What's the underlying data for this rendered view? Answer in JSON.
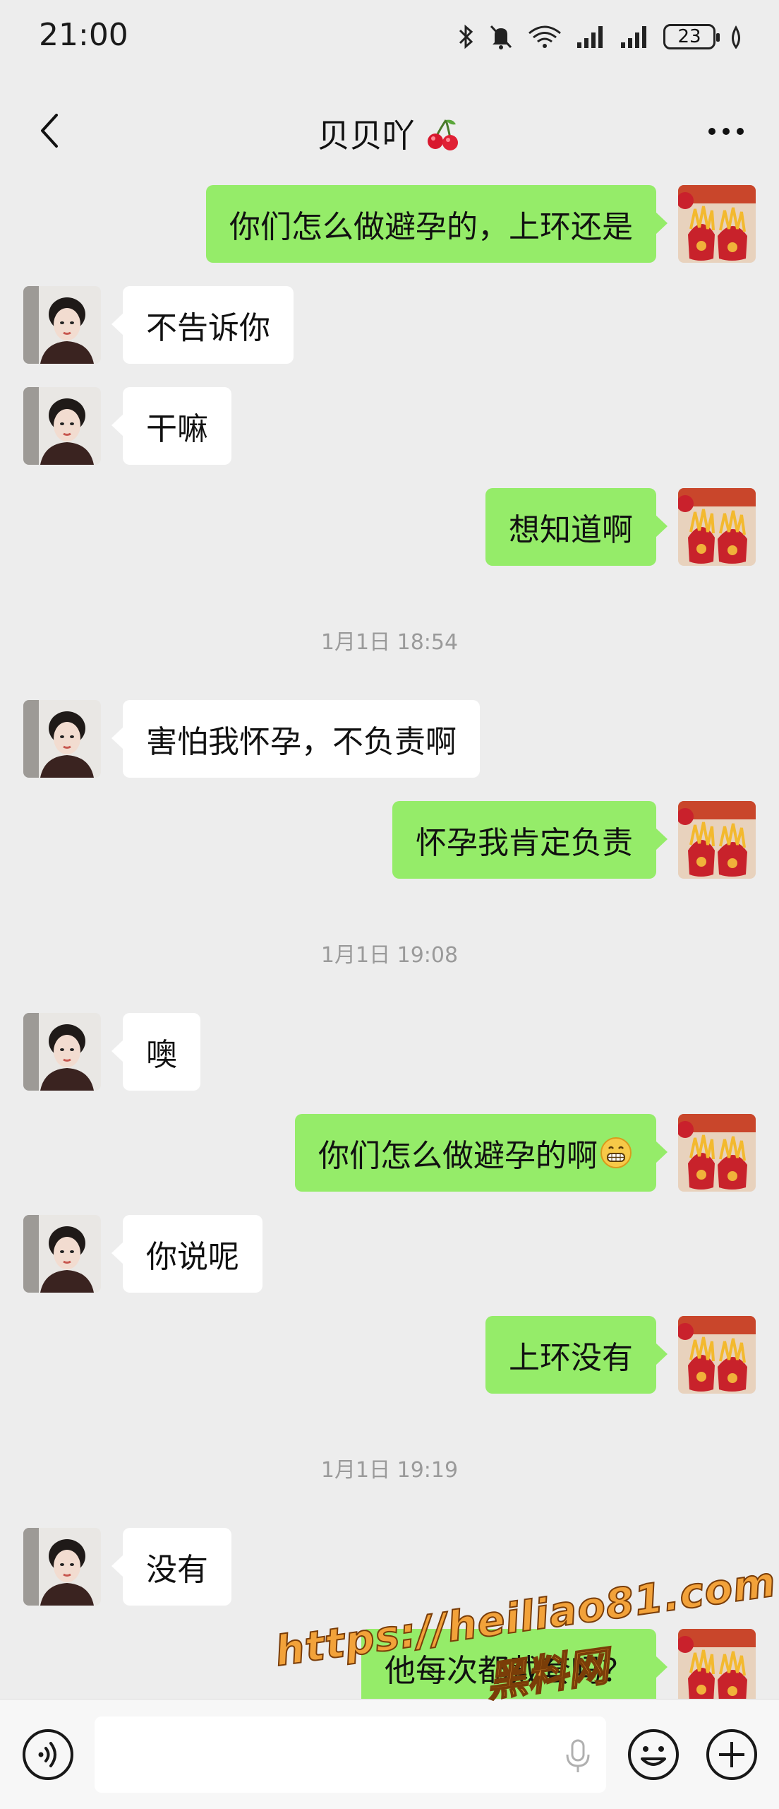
{
  "status_bar": {
    "time": "21:00",
    "battery": "23",
    "icons": [
      "bluetooth-icon",
      "mute-bell-icon",
      "wifi-icon",
      "signal-icon",
      "signal-icon",
      "battery-icon",
      "leaf-icon"
    ]
  },
  "header": {
    "title": "贝贝吖",
    "title_emoji": "cherry-icon",
    "back_icon": "chevron-left-icon",
    "more_icon": "more-dots-icon"
  },
  "messages": [
    {
      "side": "right",
      "text": "你们怎么做避孕的，上环还是"
    },
    {
      "side": "left",
      "text": "不告诉你"
    },
    {
      "side": "left",
      "text": "干嘛"
    },
    {
      "side": "right",
      "text": "想知道啊"
    },
    {
      "type": "time",
      "text": "1月1日 18:54"
    },
    {
      "side": "left",
      "text": "害怕我怀孕，不负责啊"
    },
    {
      "side": "right",
      "text": "怀孕我肯定负责"
    },
    {
      "type": "time",
      "text": "1月1日 19:08"
    },
    {
      "side": "left",
      "text": "噢"
    },
    {
      "side": "right",
      "text": "你们怎么做避孕的啊",
      "emoji": "grinning-face-icon"
    },
    {
      "side": "left",
      "text": "你说呢"
    },
    {
      "side": "right",
      "text": "上环没有"
    },
    {
      "type": "time",
      "text": "1月1日 19:19"
    },
    {
      "side": "left",
      "text": "没有"
    },
    {
      "side": "right",
      "text": "他每次都戴套吗？"
    }
  ],
  "input_bar": {
    "voice_icon": "voice-mode-icon",
    "mic_icon": "microphone-icon",
    "emoji_icon": "emoji-icon",
    "plus_icon": "plus-icon"
  },
  "watermark": {
    "url": "https://heiliao81.com",
    "name": "黑料网"
  },
  "colors": {
    "background": "#ededed",
    "bubble_self": "#95ec69",
    "bubble_other": "#ffffff",
    "timestamp": "#9a9a9a",
    "watermark": "#f2a23a"
  }
}
